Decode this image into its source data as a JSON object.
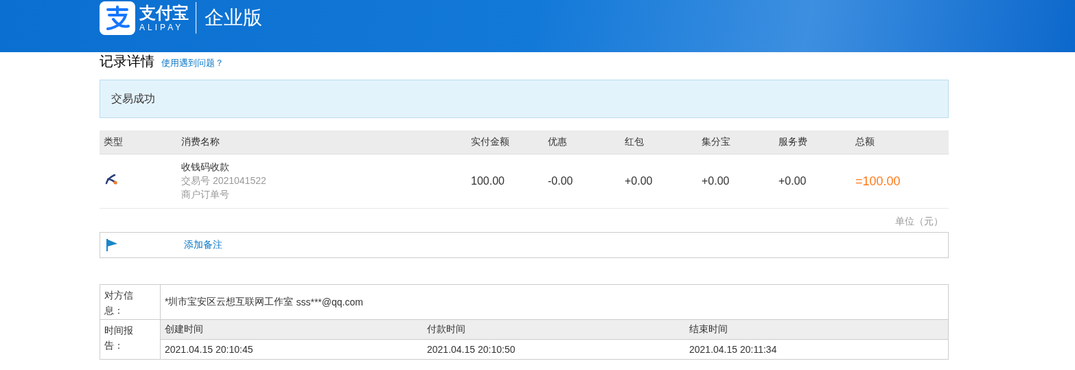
{
  "header": {
    "logo_text": "支付宝",
    "logo_sub": "ALIPAY",
    "edition": "企业版"
  },
  "page": {
    "title": "记录详情",
    "help_link": "使用遇到问题？"
  },
  "status": "交易成功",
  "table": {
    "columns": [
      "类型",
      "消费名称",
      "实付金额",
      "优惠",
      "红包",
      "集分宝",
      "服务费",
      "总额"
    ],
    "rows": [
      {
        "cells": [
          {
            "kind": "icon"
          },
          {
            "kind": "name",
            "name": "收钱码收款",
            "trade_no": "交易号 2021041522",
            "order_no": "商户订单号"
          },
          {
            "kind": "amount",
            "text": "100.00"
          },
          {
            "kind": "amount",
            "text": "-0.00"
          },
          {
            "kind": "amount",
            "text": "+0.00"
          },
          {
            "kind": "amount",
            "text": "+0.00"
          },
          {
            "kind": "amount",
            "text": "+0.00"
          },
          {
            "kind": "total",
            "text": "=100.00"
          }
        ]
      }
    ]
  },
  "unit": "单位（元）",
  "remark": {
    "link": "添加备注"
  },
  "info": {
    "counterparty_label": "对方信息：",
    "counterparty_name": "*圳市宝安区云想互联网工作室",
    "counterparty_account": "sss***@qq.com",
    "time_label": "时间报告：",
    "time_columns": [
      "创建时间",
      "付款时间",
      "结束时间"
    ],
    "time_values": [
      "2021.04.15 20:10:45",
      "2021.04.15 20:10:50",
      "2021.04.15 20:11:34"
    ]
  }
}
